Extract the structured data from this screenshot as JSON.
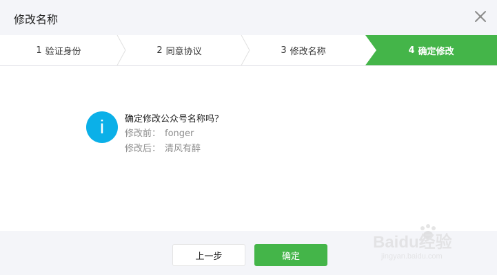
{
  "dialog": {
    "title": "修改名称",
    "close_icon": "close-icon"
  },
  "steps": [
    {
      "num": "1",
      "label": "验证身份",
      "active": false
    },
    {
      "num": "2",
      "label": "同意协议",
      "active": false
    },
    {
      "num": "3",
      "label": "修改名称",
      "active": false
    },
    {
      "num": "4",
      "label": "确定修改",
      "active": true
    }
  ],
  "message": {
    "icon": "info-icon",
    "icon_glyph": "i",
    "question": "确定修改公众号名称吗？",
    "before_label": "修改前：",
    "before_value": "fonger",
    "after_label": "修改后：",
    "after_value": "清风有醉"
  },
  "footer": {
    "prev_label": "上一步",
    "ok_label": "确定"
  },
  "watermark": {
    "brand": "Baidu经验",
    "url": "jingyan.baidu.com"
  },
  "colors": {
    "accent_green": "#44b549",
    "info_blue": "#0bb0e8",
    "background": "#f4f5f9"
  }
}
